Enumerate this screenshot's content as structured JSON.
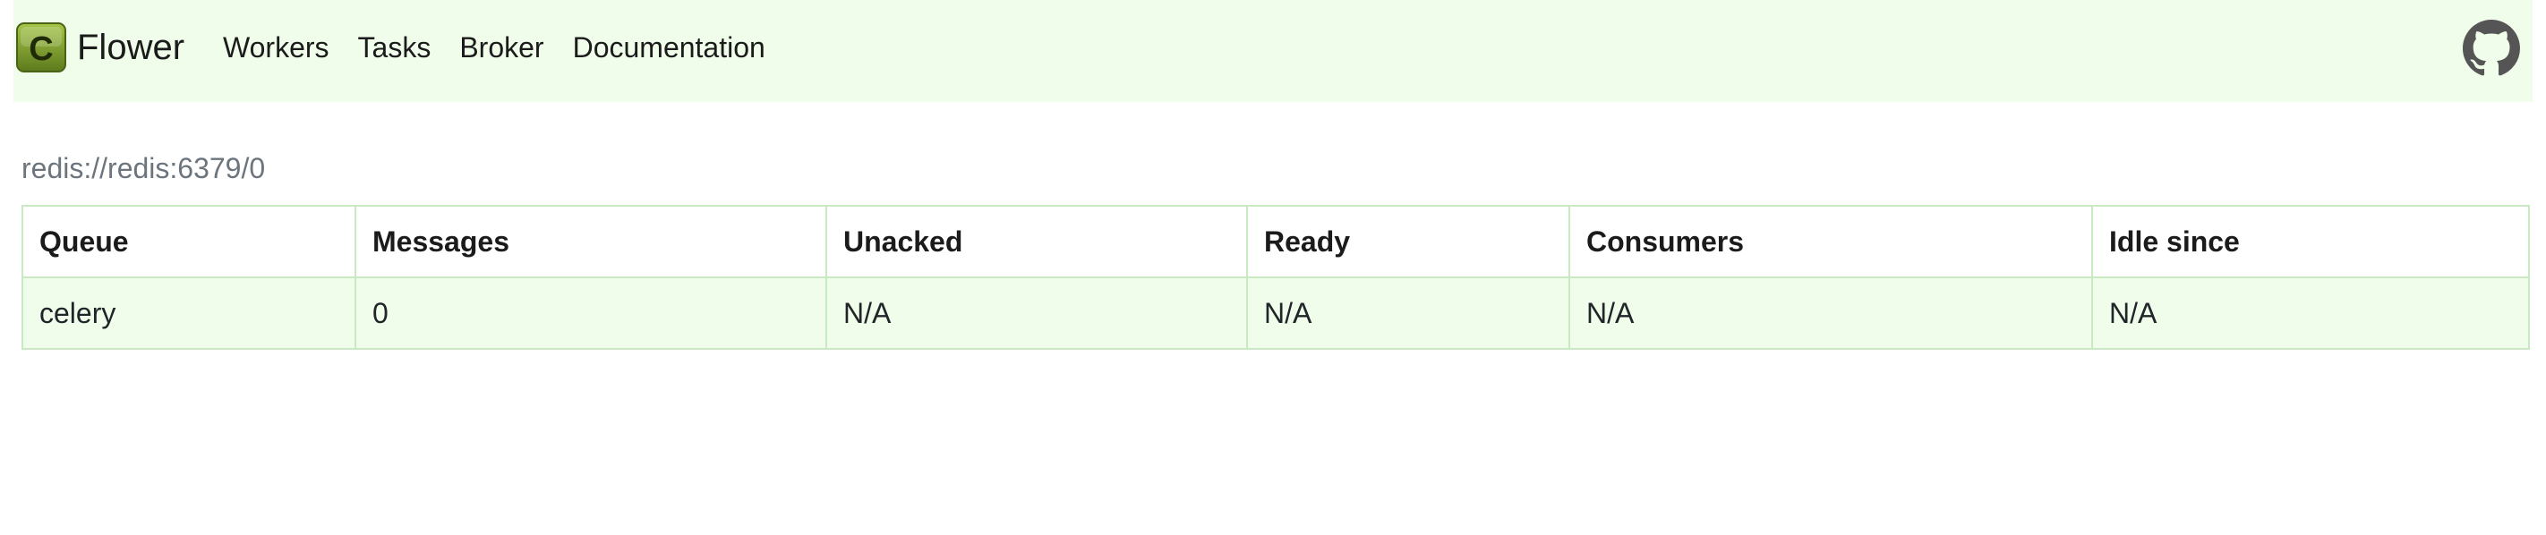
{
  "nav": {
    "brand": "Flower",
    "logo_letter": "C",
    "links": [
      "Workers",
      "Tasks",
      "Broker",
      "Documentation"
    ]
  },
  "broker": {
    "url": "redis://redis:6379/0"
  },
  "table": {
    "headers": [
      "Queue",
      "Messages",
      "Unacked",
      "Ready",
      "Consumers",
      "Idle since"
    ],
    "rows": [
      [
        "celery",
        "0",
        "N/A",
        "N/A",
        "N/A",
        "N/A"
      ]
    ]
  },
  "colors": {
    "nav_bg": "#f0fdea",
    "row_bg": "#f0fdea",
    "border": "#c9e9c3",
    "muted_text": "#6c757d"
  },
  "icons": {
    "logo": "celery-logo-icon",
    "github": "github-icon"
  }
}
